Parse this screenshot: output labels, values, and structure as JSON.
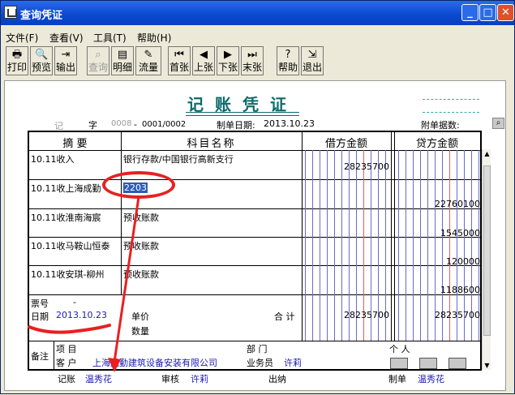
{
  "window": {
    "title": "查询凭证"
  },
  "menus": [
    "文件(F)",
    "查看(V)",
    "工具(T)",
    "帮助(H)"
  ],
  "toolbar": [
    {
      "label": "打印",
      "icon": "printer-icon",
      "glyph": "🖶",
      "enabled": true
    },
    {
      "label": "预览",
      "icon": "preview-icon",
      "glyph": "🔍",
      "enabled": true
    },
    {
      "label": "输出",
      "icon": "export-icon",
      "glyph": "⇥",
      "enabled": true
    },
    {
      "label": "查询",
      "icon": "binoculars-icon",
      "glyph": "⌕",
      "enabled": false
    },
    {
      "label": "明细",
      "icon": "detail-icon",
      "glyph": "▤",
      "enabled": true
    },
    {
      "label": "流量",
      "icon": "flow-icon",
      "glyph": "✎",
      "enabled": true
    },
    {
      "label": "首张",
      "icon": "first-icon",
      "glyph": "⏮",
      "enabled": true
    },
    {
      "label": "上张",
      "icon": "prev-icon",
      "glyph": "◀",
      "enabled": true
    },
    {
      "label": "下张",
      "icon": "next-icon",
      "glyph": "▶",
      "enabled": true
    },
    {
      "label": "末张",
      "icon": "last-icon",
      "glyph": "⏭",
      "enabled": true
    },
    {
      "label": "帮助",
      "icon": "help-icon",
      "glyph": "?",
      "enabled": true
    },
    {
      "label": "退出",
      "icon": "exit-icon",
      "glyph": "⇲",
      "enabled": true
    }
  ],
  "voucher": {
    "title": "记账凭证",
    "type_prefix": "记",
    "zi": "字",
    "num_gray": "0008",
    "dash": "-",
    "num": "0001/0002",
    "date_label": "制单日期:",
    "date": "2013.10.23",
    "attach_label": "附单据数:",
    "headers": {
      "summary": "摘  要",
      "account": "科目名称",
      "debit": "借方金额",
      "credit": "贷方金额"
    },
    "rows": [
      {
        "summary": "10.11收入",
        "account": "银行存款/中国银行高新支行",
        "debit": "28235700",
        "credit": ""
      },
      {
        "summary": "10.11收上海成勤",
        "account": "2203",
        "debit": "",
        "credit": "22760100"
      },
      {
        "summary": "10.11收淮南海宸",
        "account": "预收账款",
        "debit": "",
        "credit": "1545000"
      },
      {
        "summary": "10.11收马鞍山恒泰",
        "account": "预收账款",
        "debit": "",
        "credit": "120000"
      },
      {
        "summary": "10.11收安琪-柳州",
        "account": "预收账款",
        "debit": "",
        "credit": "1188600"
      }
    ],
    "footer": {
      "ticket_label": "票号",
      "ticket_dash": "-",
      "date_label": "日期",
      "date_value": "2013.10.23",
      "price_label": "单价",
      "qty_label": "数量",
      "total_label": "合  计",
      "total_debit": "28235700",
      "total_credit": "28235700"
    },
    "notes": {
      "label": "备注",
      "project_label": "项  目",
      "dept_label": "部  门",
      "person_label": "个  人",
      "customer_label": "客  户",
      "customer_value": "上海成勤建筑设备安装有限公司",
      "sales_label": "业务员",
      "sales_value": "许莉"
    },
    "signoff": {
      "book_label": "记账",
      "book_value": "温秀花",
      "audit_label": "审核",
      "audit_value": "许莉",
      "cashier_label": "出纳",
      "cashier_value": "",
      "maker_label": "制单",
      "maker_value": "温秀花"
    }
  }
}
